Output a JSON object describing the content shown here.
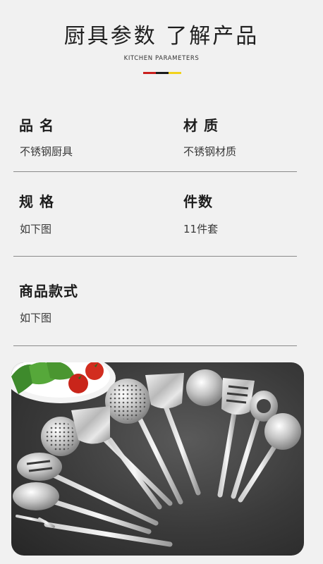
{
  "header": {
    "title": "厨具参数 了解产品",
    "subtitle": "KITCHEN PARAMETERS",
    "accent_colors": [
      "#c9201e",
      "#1b1b1b",
      "#f2d21c"
    ]
  },
  "params": [
    {
      "label": "品 名",
      "value": "不锈钢厨具"
    },
    {
      "label": "材 质",
      "value": "不锈钢材质"
    },
    {
      "label": "规 格",
      "value": "如下图"
    },
    {
      "label": "件数",
      "value": "11件套"
    },
    {
      "label": "商品款式",
      "value": "如下图"
    }
  ],
  "product_photo": {
    "icon": "stainless-kitchen-utensil-set-photo"
  }
}
